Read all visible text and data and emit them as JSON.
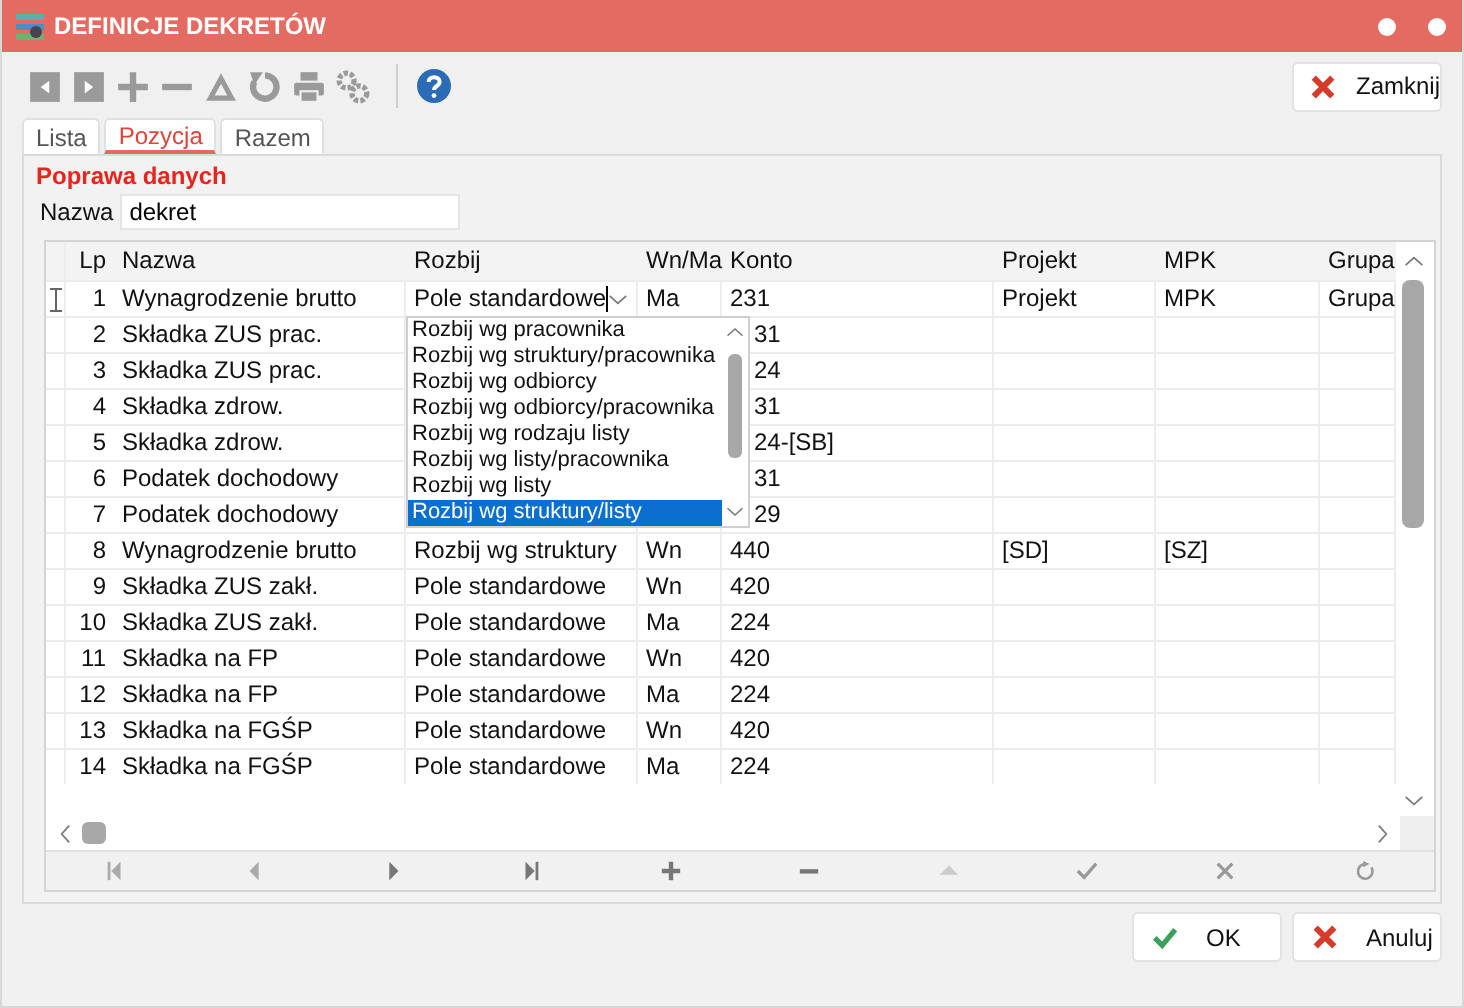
{
  "window": {
    "title": "DEFINICJE DEKRETÓW"
  },
  "toolbar": {
    "close_button": "Zamknij"
  },
  "tabs": [
    {
      "label": "Lista",
      "selected": false
    },
    {
      "label": "Pozycja",
      "selected": true
    },
    {
      "label": "Razem",
      "selected": false
    }
  ],
  "section_title": "Poprawa danych",
  "name_field": {
    "label": "Nazwa",
    "value": "dekret"
  },
  "table": {
    "columns": [
      "Lp",
      "Nazwa",
      "Rozbij",
      "Wn/Ma",
      "Konto",
      "Projekt",
      "MPK",
      "Grupa"
    ],
    "rows": [
      {
        "selected": true,
        "lp": "1",
        "nazwa": "Wynagrodzenie brutto",
        "rozbij": "Pole standardowe",
        "wn_ma": "Ma",
        "konto": "231",
        "projekt": "Projekt",
        "mpk": "MPK",
        "grupa": "Grupa"
      },
      {
        "selected": false,
        "lp": "2",
        "nazwa": "Składka ZUS prac.",
        "konto": "31"
      },
      {
        "selected": false,
        "lp": "3",
        "nazwa": "Składka ZUS prac.",
        "konto": "24"
      },
      {
        "selected": false,
        "lp": "4",
        "nazwa": "Składka zdrow.",
        "konto": "31"
      },
      {
        "selected": false,
        "lp": "5",
        "nazwa": "Składka zdrow.",
        "konto": "24-[SB]"
      },
      {
        "selected": false,
        "lp": "6",
        "nazwa": "Podatek dochodowy",
        "konto": "31"
      },
      {
        "selected": false,
        "lp": "7",
        "nazwa": "Podatek dochodowy",
        "konto": "29"
      },
      {
        "selected": false,
        "lp": "8",
        "nazwa": "Wynagrodzenie brutto",
        "rozbij": "Rozbij wg struktury",
        "wn_ma": "Wn",
        "konto": "440",
        "projekt": "[SD]",
        "mpk": "[SZ]"
      },
      {
        "selected": false,
        "lp": "9",
        "nazwa": "Składka ZUS zakł.",
        "rozbij": "Pole standardowe",
        "wn_ma": "Wn",
        "konto": "420"
      },
      {
        "selected": false,
        "lp": "10",
        "nazwa": "Składka ZUS zakł.",
        "rozbij": "Pole standardowe",
        "wn_ma": "Ma",
        "konto": "224"
      },
      {
        "selected": false,
        "lp": "11",
        "nazwa": "Składka na FP",
        "rozbij": "Pole standardowe",
        "wn_ma": "Wn",
        "konto": "420"
      },
      {
        "selected": false,
        "lp": "12",
        "nazwa": "Składka na FP",
        "rozbij": "Pole standardowe",
        "wn_ma": "Ma",
        "konto": "224"
      },
      {
        "selected": false,
        "lp": "13",
        "nazwa": "Składka na FGŚP",
        "rozbij": "Pole standardowe",
        "wn_ma": "Wn",
        "konto": "420"
      },
      {
        "selected": false,
        "lp": "14",
        "nazwa": "Składka na FGŚP",
        "rozbij": "Pole standardowe",
        "wn_ma": "Ma",
        "konto": "224"
      }
    ]
  },
  "dropdown": {
    "items": [
      {
        "label": "Rozbij wg pracownika",
        "selected": false
      },
      {
        "label": "Rozbij wg struktury/pracownika",
        "selected": false
      },
      {
        "label": "Rozbij wg odbiorcy",
        "selected": false
      },
      {
        "label": "Rozbij wg odbiorcy/pracownika",
        "selected": false
      },
      {
        "label": "Rozbij wg rodzaju listy",
        "selected": false
      },
      {
        "label": "Rozbij wg listy/pracownika",
        "selected": false
      },
      {
        "label": "Rozbij wg listy",
        "selected": false
      },
      {
        "label": "Rozbij wg struktury/listy",
        "selected": true
      }
    ]
  },
  "buttons": {
    "ok": "OK",
    "cancel": "Anuluj"
  }
}
